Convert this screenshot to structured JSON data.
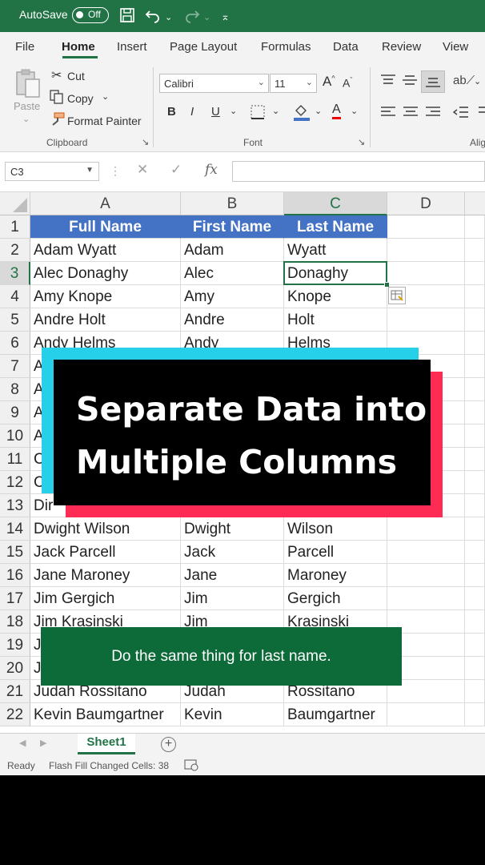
{
  "titlebar": {
    "autosave": "AutoSave",
    "toggle": "Off"
  },
  "tabs": [
    "File",
    "Home",
    "Insert",
    "Page Layout",
    "Formulas",
    "Data",
    "Review",
    "View"
  ],
  "clipboard": {
    "paste": "Paste",
    "cut": "Cut",
    "copy": "Copy",
    "format_painter": "Format Painter",
    "group": "Clipboard"
  },
  "font": {
    "name": "Calibri",
    "size": "11",
    "bold": "B",
    "italic": "I",
    "underline": "U",
    "group": "Font"
  },
  "alignment": {
    "group": "Alig"
  },
  "formula_bar": {
    "cell_ref": "C3",
    "fx": "fx"
  },
  "grid": {
    "columns": [
      "A",
      "B",
      "C",
      "D"
    ],
    "rows": [
      {
        "n": "1",
        "a": "Full Name",
        "b": "First Name",
        "c": "Last Name"
      },
      {
        "n": "2",
        "a": "Adam Wyatt",
        "b": "Adam",
        "c": "Wyatt"
      },
      {
        "n": "3",
        "a": "Alec Donaghy",
        "b": "Alec",
        "c": "Donaghy"
      },
      {
        "n": "4",
        "a": "Amy Knope",
        "b": "Amy",
        "c": "Knope"
      },
      {
        "n": "5",
        "a": "Andre Holt",
        "b": "Andre",
        "c": "Holt"
      },
      {
        "n": "6",
        "a": "Andy Helms",
        "b": "Andy",
        "c": "Helms"
      },
      {
        "n": "7",
        "a": "A",
        "b": "",
        "c": ""
      },
      {
        "n": "8",
        "a": "A",
        "b": "",
        "c": ""
      },
      {
        "n": "9",
        "a": "A",
        "b": "",
        "c": ""
      },
      {
        "n": "10",
        "a": "A",
        "b": "",
        "c": ""
      },
      {
        "n": "11",
        "a": "C",
        "b": "",
        "c": ""
      },
      {
        "n": "12",
        "a": "C",
        "b": "",
        "c": ""
      },
      {
        "n": "13",
        "a": "Dir",
        "b": "",
        "c": ""
      },
      {
        "n": "14",
        "a": "Dwight Wilson",
        "b": "Dwight",
        "c": "Wilson"
      },
      {
        "n": "15",
        "a": "Jack Parcell",
        "b": "Jack",
        "c": "Parcell"
      },
      {
        "n": "16",
        "a": "Jane Maroney",
        "b": "Jane",
        "c": "Maroney"
      },
      {
        "n": "17",
        "a": "Jim Gergich",
        "b": "Jim",
        "c": "Gergich"
      },
      {
        "n": "18",
        "a": "Jim Krasinski",
        "b": "Jim",
        "c": "Krasinski"
      },
      {
        "n": "19",
        "a": "J",
        "b": "",
        "c": ""
      },
      {
        "n": "20",
        "a": "J",
        "b": "",
        "c": ""
      },
      {
        "n": "21",
        "a": "Judah Rossitano",
        "b": "Judah",
        "c": "Rossitano"
      },
      {
        "n": "22",
        "a": "Kevin Baumgartner",
        "b": "Kevin",
        "c": "Baumgartner"
      }
    ]
  },
  "sheet_tab": "Sheet1",
  "status": {
    "ready": "Ready",
    "flash_fill": "Flash Fill Changed Cells: 38"
  },
  "overlay": {
    "line1": "Separate Data into",
    "line2": "Multiple Columns"
  },
  "caption": "Do the same thing for last name.",
  "colors": {
    "excel_green": "#217346",
    "header_blue": "#4472c4",
    "cyan": "#25d0e8",
    "red": "#fe2c55",
    "caption_green": "#0d6b3a"
  }
}
